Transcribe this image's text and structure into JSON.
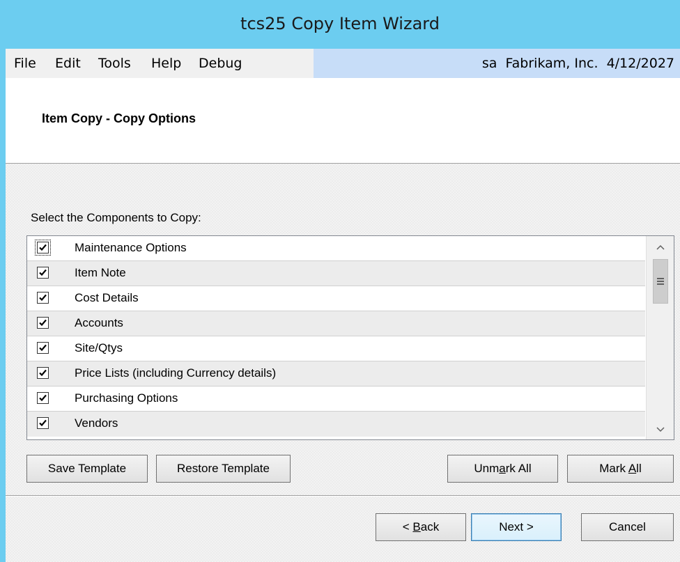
{
  "window": {
    "title": "tcs25 Copy Item Wizard"
  },
  "menu": {
    "items": [
      "File",
      "Edit",
      "Tools",
      "Help",
      "Debug"
    ],
    "status": "sa  Fabrikam, Inc.  4/12/2027"
  },
  "header": {
    "title": "Item Copy - Copy Options"
  },
  "components": {
    "label": "Select the Components to Copy:",
    "rows": [
      {
        "label": "Maintenance Options",
        "checked": true
      },
      {
        "label": "Item Note",
        "checked": true
      },
      {
        "label": "Cost Details",
        "checked": true
      },
      {
        "label": "Accounts",
        "checked": true
      },
      {
        "label": "Site/Qtys",
        "checked": true
      },
      {
        "label": "Price Lists (including Currency details)",
        "checked": true
      },
      {
        "label": "Purchasing Options",
        "checked": true
      },
      {
        "label": "Vendors",
        "checked": true
      }
    ]
  },
  "buttons": {
    "save_template": "Save Template",
    "restore_template": "Restore Template",
    "unmark_all_pre": "Unm",
    "unmark_all_key": "a",
    "unmark_all_post": "rk All",
    "mark_all_pre": "Mark ",
    "mark_all_key": "A",
    "mark_all_post": "ll",
    "back_pre": "< ",
    "back_key": "B",
    "back_post": "ack",
    "next": "Next >",
    "cancel": "Cancel"
  }
}
